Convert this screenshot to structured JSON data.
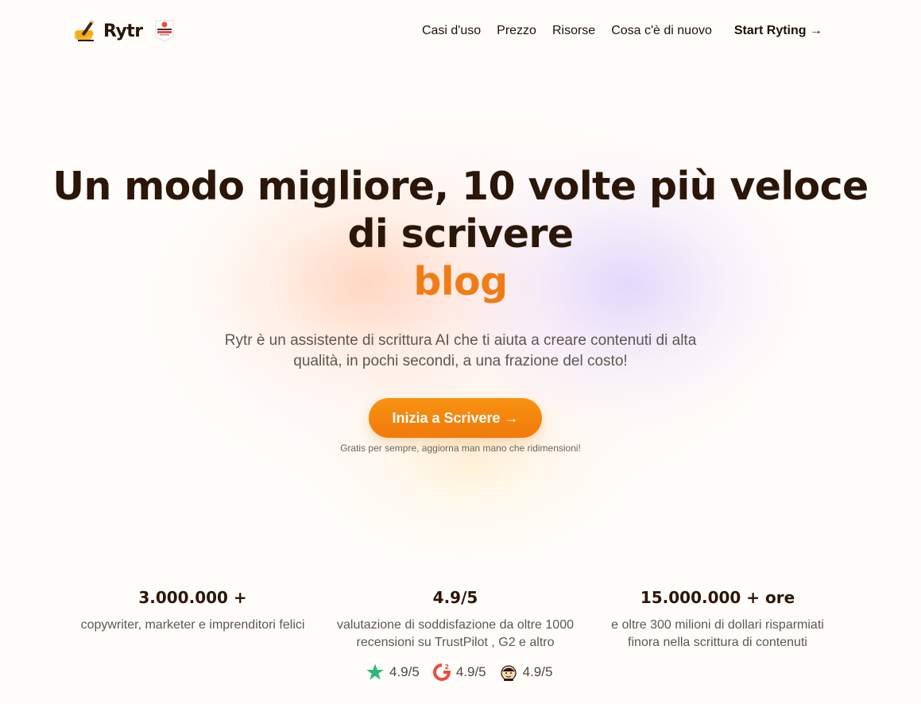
{
  "brand": {
    "name": "Rytr",
    "logo_icon": "writing-hand-icon",
    "badge": "g2-leader-badge-icon"
  },
  "nav": {
    "items": [
      "Casi d'uso",
      "Prezzo",
      "Risorse",
      "Cosa c'è di nuovo"
    ],
    "cta": "Start Ryting →"
  },
  "hero": {
    "title_line1": "Un modo migliore, 10 volte più veloce",
    "title_line2": "di scrivere",
    "rotating_word": "blog",
    "subtitle": "Rytr è un assistente di scrittura AI che ti aiuta a creare contenuti di alta qualità, in pochi secondi, a una frazione del costo!",
    "cta": "Inizia a Scrivere →",
    "note": "Gratis per sempre, aggiorna man mano che ridimensioni!"
  },
  "stats": [
    {
      "value": "3.000.000 +",
      "description": "copywriter, marketer e imprenditori felici"
    },
    {
      "value": "4.9/5",
      "description": "valutazione di soddisfazione da oltre 1000 recensioni su TrustPilot , G2 e altro"
    },
    {
      "value": "15.000.000 + ore",
      "description": "e oltre 300 milioni di dollari risparmiati finora nella scrittura di contenuti"
    }
  ],
  "ratings": [
    {
      "icon": "trustpilot-star-icon",
      "value": "4.9/5"
    },
    {
      "icon": "g2-logo-icon",
      "value": "4.9/5"
    },
    {
      "icon": "mascot-icon",
      "value": "4.9/5"
    }
  ],
  "colors": {
    "accent": "#f07c16",
    "text": "#2b1608",
    "background": "#fffdf9"
  }
}
